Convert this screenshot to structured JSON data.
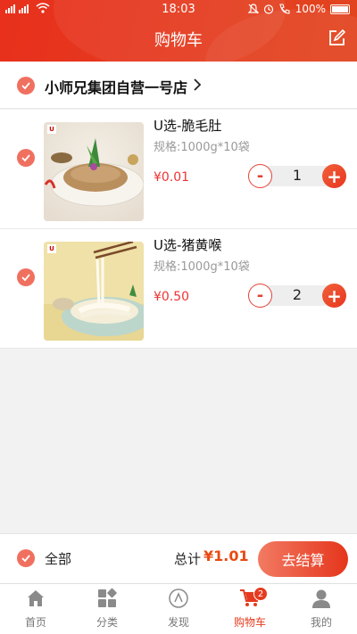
{
  "status_bar": {
    "signal": "4G 4G",
    "time": "18:03",
    "battery": "100%"
  },
  "header": {
    "title": "购物车"
  },
  "store": {
    "name": "小师兄集团自营一号店",
    "selected": true
  },
  "items": [
    {
      "name": "U选-脆毛肚",
      "spec": "规格:1000g*10袋",
      "price": "¥0.01",
      "quantity": "1",
      "selected": true,
      "minus": "-",
      "plus": "+"
    },
    {
      "name": "U选-猪黄喉",
      "spec": "规格:1000g*10袋",
      "price": "¥0.50",
      "quantity": "2",
      "selected": true,
      "minus": "-",
      "plus": "+"
    }
  ],
  "summary": {
    "select_all_label": "全部",
    "total_label": "总计",
    "total_value": "¥1.01",
    "checkout_label": "去结算"
  },
  "tabs": [
    {
      "label": "首页",
      "icon": "home-icon",
      "active": false
    },
    {
      "label": "分类",
      "icon": "category-icon",
      "active": false
    },
    {
      "label": "发现",
      "icon": "discover-icon",
      "active": false
    },
    {
      "label": "购物车",
      "icon": "cart-icon",
      "active": true,
      "badge": "2"
    },
    {
      "label": "我的",
      "icon": "profile-icon",
      "active": false
    }
  ],
  "colors": {
    "accent": "#e53a1f",
    "check": "#f07060",
    "price": "#e33333"
  }
}
